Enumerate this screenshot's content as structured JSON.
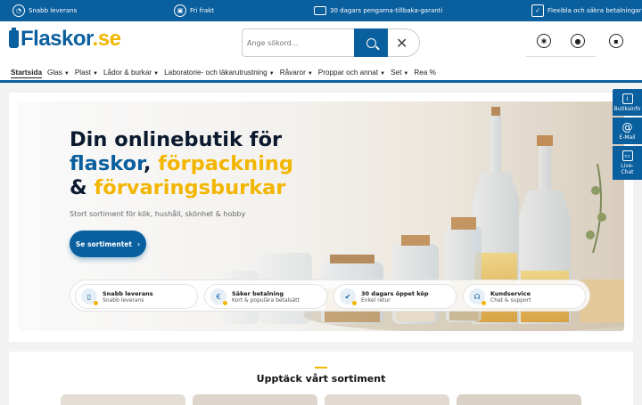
{
  "topbar": {
    "items": [
      {
        "icon": "speedometer-icon",
        "label": "Snabb leverans"
      },
      {
        "icon": "package-icon",
        "label": "Fri frakt"
      },
      {
        "icon": "credit-card-icon",
        "label": "30 dagars pengarna-tillbaka-garanti"
      },
      {
        "icon": "checklist-icon",
        "label": "Flexibla och säkra betalningar"
      }
    ]
  },
  "header": {
    "logo_text": "Flaskor",
    "logo_tld": ".se",
    "search_placeholder": "Ange sökord...",
    "icons": [
      "accessibility-icon",
      "user-icon",
      "lock-icon"
    ]
  },
  "nav": {
    "items": [
      {
        "label": "Startsida",
        "active": true,
        "has_menu": false
      },
      {
        "label": "Glas",
        "has_menu": true
      },
      {
        "label": "Plast",
        "has_menu": true
      },
      {
        "label": "Lådor & burkar",
        "has_menu": true
      },
      {
        "label": "Laboratorie- och läkarutrustning",
        "has_menu": true
      },
      {
        "label": "Råvaror",
        "has_menu": true
      },
      {
        "label": "Proppar och annat",
        "has_menu": true
      },
      {
        "label": "Set",
        "has_menu": true
      },
      {
        "label": "Rea %",
        "has_menu": false
      }
    ]
  },
  "hero": {
    "title_line1": "Din onlinebutik för",
    "title_line2_blue": "flaskor",
    "title_line2_sep": ", ",
    "title_line2_yellow": "förpackning",
    "title_line3_amp": "& ",
    "title_line3_yellow": "förvaringsburkar",
    "subtitle": "Stort sortiment för kök, hushåll, skönhet & hobby",
    "cta_label": "Se sortimentet",
    "cta_arrow": "›"
  },
  "usps": [
    {
      "icon": "phone-icon",
      "title": "Snabb leverans",
      "sub": "Snabb leverans"
    },
    {
      "icon": "euro-icon",
      "title": "Säker betalning",
      "sub": "Kort & populära betalsätt"
    },
    {
      "icon": "check-icon",
      "title": "30 dagars öppet köp",
      "sub": "Enkel retur"
    },
    {
      "icon": "headset-icon",
      "title": "Kundservice",
      "sub": "Chat & support"
    }
  ],
  "sidebar": [
    {
      "icon": "info-icon",
      "label": "Butiksinfo"
    },
    {
      "icon": "at-icon",
      "label": "E-Mail"
    },
    {
      "icon": "chat-icon",
      "label": "Live-\nChat"
    }
  ],
  "section": {
    "title": "Upptäck vårt sortiment"
  },
  "colors": {
    "brand_blue": "#0a5f9e",
    "accent_yellow": "#f3b600"
  }
}
